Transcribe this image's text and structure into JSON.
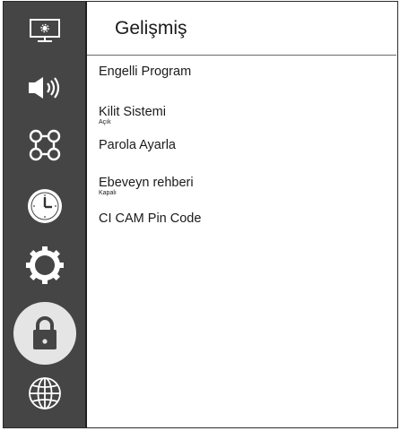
{
  "header": {
    "title": "Gelişmiş"
  },
  "sidebar": {
    "items": [
      {
        "icon": "display-settings-icon",
        "active": false
      },
      {
        "icon": "speaker-icon",
        "active": false
      },
      {
        "icon": "command-icon",
        "active": false
      },
      {
        "icon": "clock-icon",
        "active": false
      },
      {
        "icon": "gear-icon",
        "active": false
      },
      {
        "icon": "lock-icon",
        "active": true
      },
      {
        "icon": "globe-icon",
        "active": false
      }
    ]
  },
  "menu": {
    "items": [
      {
        "label": "Engelli Program",
        "sub": ""
      },
      {
        "label": "Kilit Sistemi",
        "sub": "Açık"
      },
      {
        "label": "Parola Ayarla",
        "sub": ""
      },
      {
        "label": "Ebeveyn rehberi",
        "sub": "Kapalı"
      },
      {
        "label": "CI CAM Pin Code",
        "sub": ""
      }
    ]
  },
  "colors": {
    "sidebar_bg": "#454545",
    "active_bg": "#e5e5e5",
    "icon": "#ffffff",
    "text": "#1a1a1a"
  }
}
